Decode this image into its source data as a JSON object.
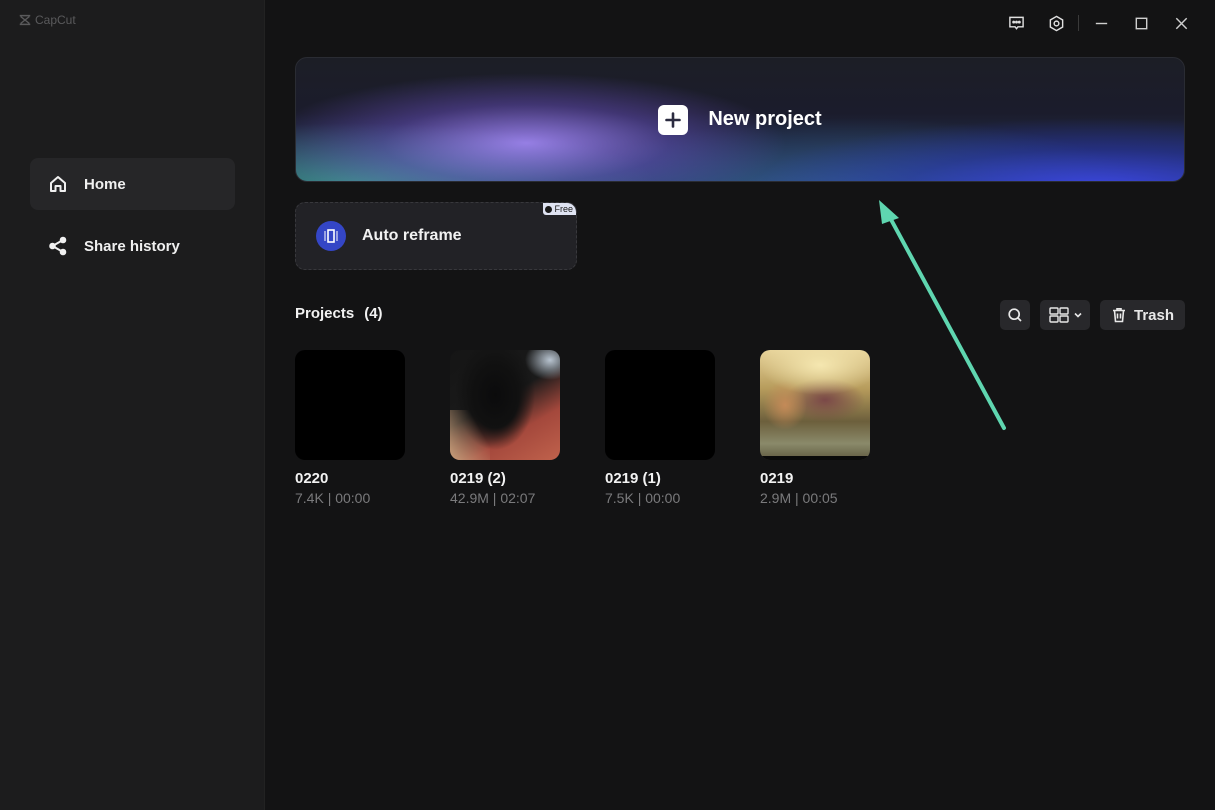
{
  "app": {
    "name": "CapCut"
  },
  "titlebar": {
    "icons": [
      "feedback-icon",
      "settings-icon",
      "minimize-icon",
      "maximize-icon",
      "close-icon"
    ]
  },
  "sidebar": {
    "items": [
      {
        "label": "Home",
        "icon": "home-icon",
        "active": true
      },
      {
        "label": "Share history",
        "icon": "share-icon",
        "active": false
      }
    ]
  },
  "new_project": {
    "label": "New project",
    "icon": "plus-icon"
  },
  "auto_reframe": {
    "label": "Auto reframe",
    "badge": "Free",
    "icon": "reframe-icon"
  },
  "projects_section": {
    "title": "Projects",
    "count": "(4)",
    "trash_label": "Trash",
    "items": [
      {
        "name": "0220",
        "meta": "7.4K | 00:00"
      },
      {
        "name": "0219 (2)",
        "meta": "42.9M | 02:07"
      },
      {
        "name": "0219 (1)",
        "meta": "7.5K | 00:00"
      },
      {
        "name": "0219",
        "meta": "2.9M | 00:05"
      }
    ]
  },
  "annotation": {
    "color": "#5fd6b0",
    "points_to": "new-project-button"
  }
}
